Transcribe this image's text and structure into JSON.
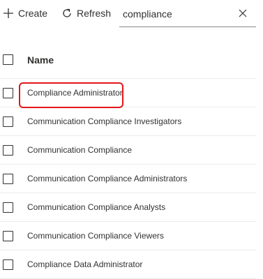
{
  "toolbar": {
    "create_label": "Create",
    "refresh_label": "Refresh"
  },
  "search": {
    "value": "compliance"
  },
  "table": {
    "column_name": "Name",
    "rows": [
      {
        "name": "Compliance Administrator"
      },
      {
        "name": "Communication Compliance Investigators"
      },
      {
        "name": "Communication Compliance"
      },
      {
        "name": "Communication Compliance Administrators"
      },
      {
        "name": "Communication Compliance Analysts"
      },
      {
        "name": "Communication Compliance Viewers"
      },
      {
        "name": "Compliance Data Administrator"
      }
    ]
  },
  "colors": {
    "highlight": "#e3151a",
    "text": "#323130",
    "divider": "#edebe9"
  }
}
